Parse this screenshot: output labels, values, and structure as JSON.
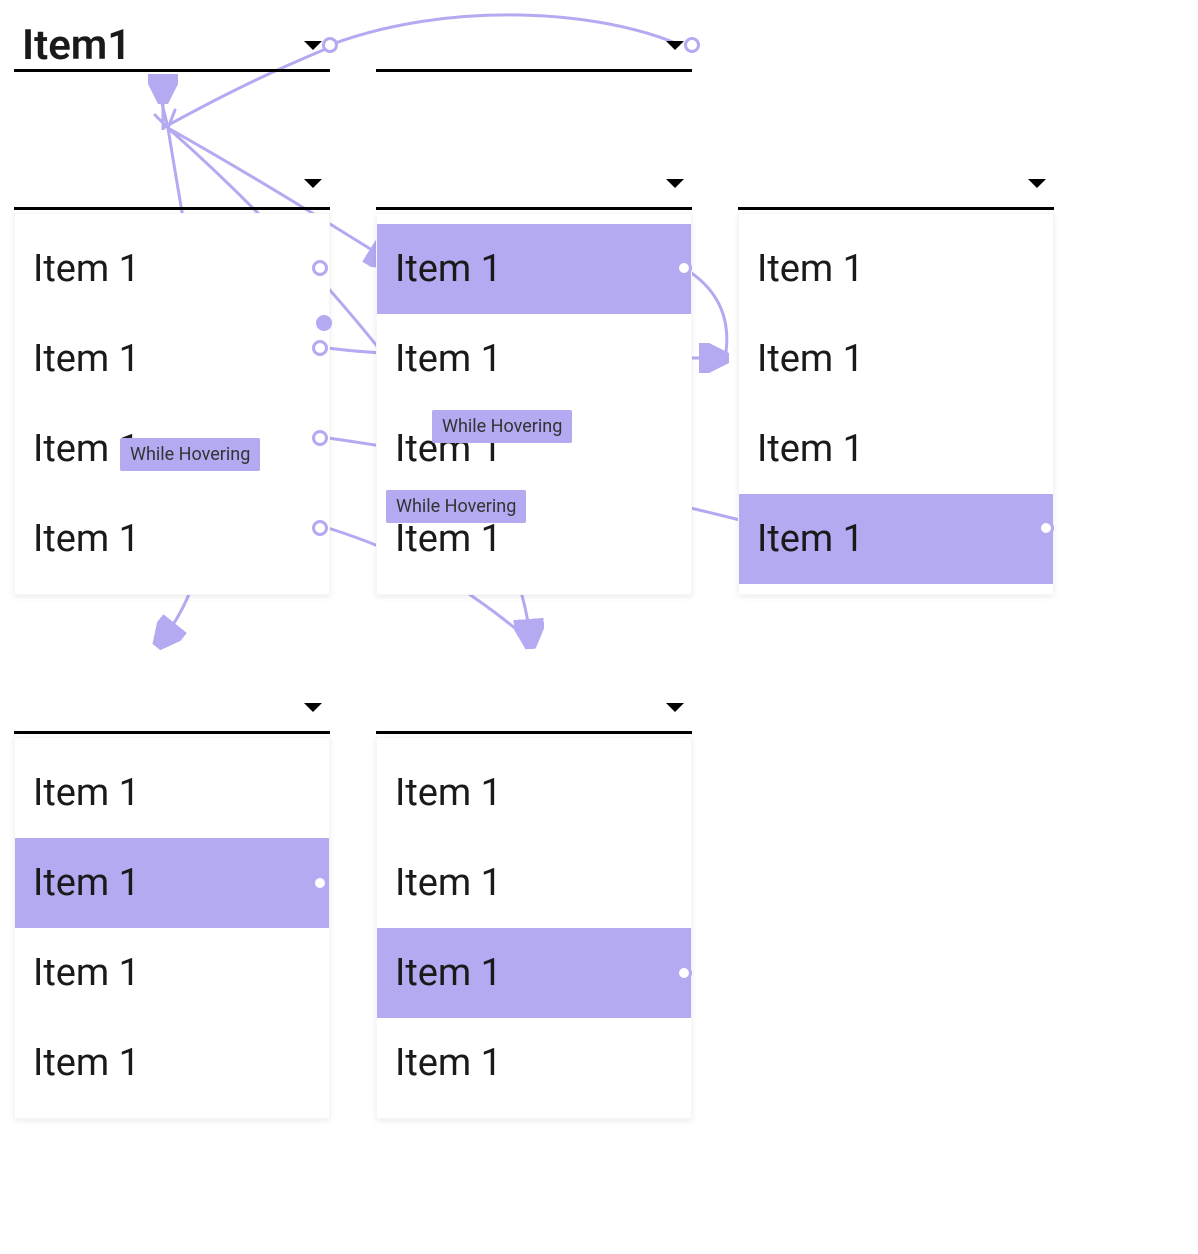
{
  "colors": {
    "highlight": "#b3aaf2",
    "connector": "#b3aaf2",
    "text": "#1a1a1a"
  },
  "badges": {
    "b1": "While Hovering",
    "b2": "While Hovering",
    "b3": "While Hovering"
  },
  "headers": {
    "h_top_left": {
      "label": "Item1"
    },
    "h_top_mid": {
      "label": ""
    },
    "h_r2_left": {
      "label": ""
    },
    "h_r2_mid": {
      "label": ""
    },
    "h_r2_right": {
      "label": ""
    },
    "h_r3_left": {
      "label": ""
    },
    "h_r3_mid": {
      "label": ""
    }
  },
  "menus": {
    "m_r2_left": {
      "items": [
        "Item 1",
        "Item 1",
        "Item 1",
        "Item 1"
      ],
      "highlighted_index": null
    },
    "m_r2_mid": {
      "items": [
        "Item 1",
        "Item 1",
        "Item 1",
        "Item 1"
      ],
      "highlighted_index": 0
    },
    "m_r2_right": {
      "items": [
        "Item 1",
        "Item 1",
        "Item 1",
        "Item 1"
      ],
      "highlighted_index": 3
    },
    "m_r3_left": {
      "items": [
        "Item 1",
        "Item 1",
        "Item 1",
        "Item 1"
      ],
      "highlighted_index": 1
    },
    "m_r3_mid": {
      "items": [
        "Item 1",
        "Item 1",
        "Item 1",
        "Item 1"
      ],
      "highlighted_index": 2
    }
  }
}
